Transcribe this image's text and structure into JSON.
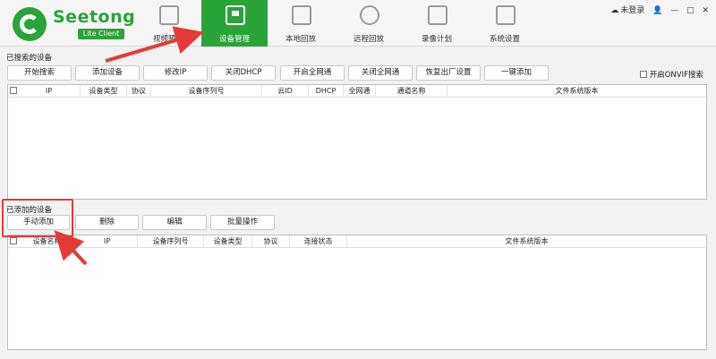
{
  "app": {
    "brand": "Seetong",
    "sub": "Lite Client"
  },
  "nav": [
    {
      "label": "视频预览",
      "icon": "preview-icon"
    },
    {
      "label": "设备管理",
      "icon": "device-manage-icon",
      "active": true
    },
    {
      "label": "本地回放",
      "icon": "local-playback-icon"
    },
    {
      "label": "远程回放",
      "icon": "remote-playback-icon"
    },
    {
      "label": "录像计划",
      "icon": "record-plan-icon"
    },
    {
      "label": "系统设置",
      "icon": "system-settings-icon"
    }
  ],
  "window": {
    "login": "未登录",
    "minimize": "—",
    "maximize": "□",
    "close": "✕"
  },
  "searched": {
    "title": "已搜索的设备",
    "buttons": [
      "开始搜索",
      "添加设备",
      "修改IP",
      "关闭DHCP",
      "开启全网通",
      "关闭全网通",
      "恢复出厂设置",
      "一键添加"
    ],
    "onvif_label": "开启ONVIF搜索",
    "columns": [
      "IP",
      "设备类型",
      "协议",
      "设备序列号",
      "云ID",
      "DHCP",
      "全网通",
      "通道名称",
      "文件系统版本"
    ]
  },
  "added": {
    "title": "已添加的设备",
    "buttons": [
      "手动添加",
      "删除",
      "编辑",
      "批量操作"
    ],
    "columns": [
      "设备名称",
      "IP",
      "设备序列号",
      "设备类型",
      "协议",
      "连接状态",
      "文件系统版本"
    ]
  },
  "colors": {
    "accent": "#2aa339",
    "annotation": "#e53a3a"
  }
}
